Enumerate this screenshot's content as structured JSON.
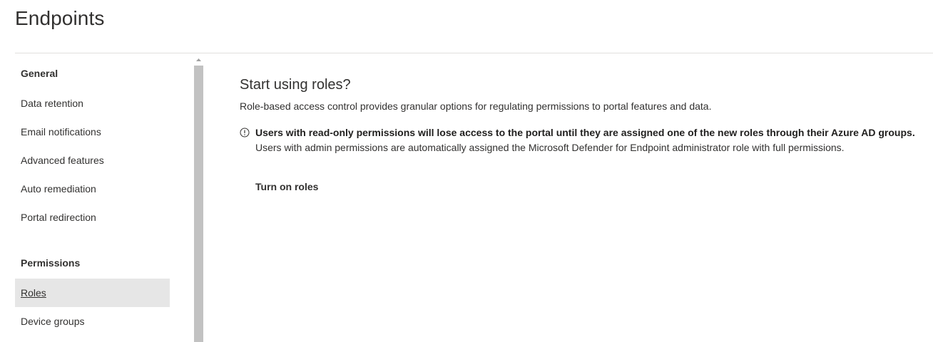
{
  "page": {
    "title": "Endpoints"
  },
  "sidebar": {
    "sections": [
      {
        "header": "General",
        "items": [
          {
            "label": "Data retention"
          },
          {
            "label": "Email notifications"
          },
          {
            "label": "Advanced features"
          },
          {
            "label": "Auto remediation"
          },
          {
            "label": "Portal redirection"
          }
        ]
      },
      {
        "header": "Permissions",
        "items": [
          {
            "label": "Roles",
            "selected": true
          },
          {
            "label": "Device groups"
          }
        ]
      }
    ]
  },
  "main": {
    "title": "Start using roles?",
    "description": "Role-based access control provides granular options for regulating permissions to portal features and data.",
    "warning": {
      "icon": "info-circle-icon",
      "bold": "Users with read-only permissions will lose access to the portal until they are assigned one of the new roles through their Azure AD groups.",
      "sub": "Users with admin permissions are automatically assigned the Microsoft Defender for Endpoint administrator role with full permissions."
    },
    "button_label": "Turn on roles"
  },
  "colors": {
    "selected_bg": "#e6e6e6",
    "scroll_thumb": "#c2c2c2",
    "divider": "#e1dfdd",
    "text": "#323130"
  }
}
